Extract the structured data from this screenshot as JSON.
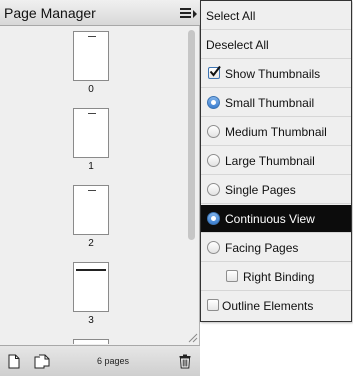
{
  "panel": {
    "title": "Page Manager",
    "thumbnails": [
      "0",
      "1",
      "2",
      "3"
    ],
    "footer": {
      "page_count": "6 pages"
    }
  },
  "menu": {
    "select_all": "Select All",
    "deselect_all": "Deselect All",
    "show_thumbnails": {
      "label": "Show Thumbnails",
      "checked": true
    },
    "thumbnail_size": {
      "options": [
        "Small Thumbnail",
        "Medium Thumbnail",
        "Large Thumbnail"
      ],
      "selected": "Small Thumbnail"
    },
    "view_mode": {
      "options": [
        "Single Pages",
        "Continuous View",
        "Facing Pages"
      ],
      "selected": "Continuous View"
    },
    "right_binding": {
      "label": "Right Binding",
      "checked": false
    },
    "outline_elements": {
      "label": "Outline Elements",
      "checked": false
    }
  },
  "colors": {
    "highlight_bg": "#0c0c0c",
    "radio_accent": "#3c7fd0",
    "panel_bg": "#efefef"
  },
  "icons": [
    "menu-icon",
    "new-page-icon",
    "duplicate-page-icon",
    "trash-icon",
    "checkmark-icon"
  ]
}
